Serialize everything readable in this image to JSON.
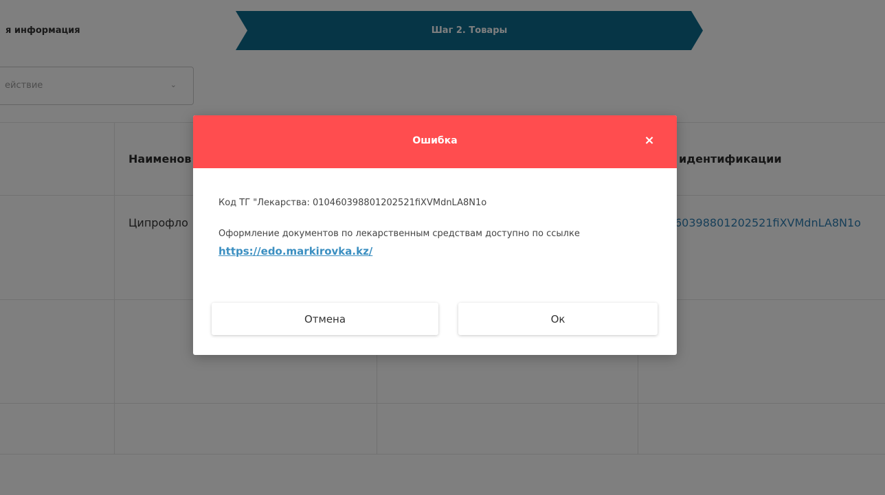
{
  "steps": {
    "previous_label": "я информация",
    "active_label": "Шаг 2. Товары"
  },
  "action_select": {
    "placeholder": "ействие"
  },
  "table": {
    "headers": {
      "name": "Наименов",
      "identification": "идентификации"
    },
    "row": {
      "name": "Ципрофло",
      "identification": "60398801202521fiXVMdnLA8N1o"
    }
  },
  "modal": {
    "title": "Ошибка",
    "close_symbol": "×",
    "code_line": "Код ТГ \"Лекарства: 010460398801202521fiXVMdnLA8N1o",
    "info_line": "Оформление документов по лекарственным средствам доступно по ссылке",
    "link_text": "https://edo.markirovka.kz/",
    "cancel_label": "Отмена",
    "ok_label": "Ок"
  },
  "colors": {
    "step_active_bg": "#0d6a8c",
    "modal_header_bg": "#ff4d4f",
    "link": "#3b8fc1",
    "overlay": "rgba(0,0,0,0.5)"
  }
}
